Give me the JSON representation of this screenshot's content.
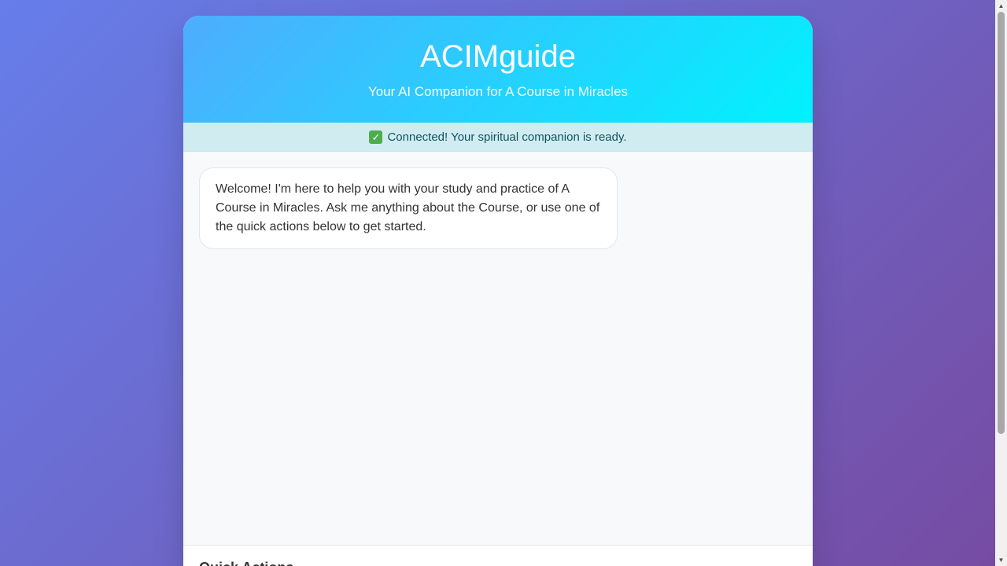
{
  "header": {
    "title": "ACIMguide",
    "subtitle": "Your AI Companion for A Course in Miracles"
  },
  "status": {
    "icon": "check-mark-icon",
    "icon_glyph": "✓",
    "text": "Connected! Your spiritual companion is ready."
  },
  "chat": {
    "messages": [
      {
        "sender": "bot",
        "text": "Welcome! I'm here to help you with your study and practice of A Course in Miracles. Ask me anything about the Course, or use one of the quick actions below to get started."
      }
    ]
  },
  "quick_actions": {
    "title": "Quick Actions"
  },
  "scrollbar": {
    "up_glyph": "▲",
    "down_glyph": "▼"
  },
  "colors": {
    "background_gradient_start": "#667eea",
    "background_gradient_end": "#764ba2",
    "header_gradient_start": "#4facfe",
    "header_gradient_end": "#00f2fe",
    "status_background": "#d1ecf1",
    "status_text": "#0c5460",
    "chat_background": "#f8f9fa"
  }
}
